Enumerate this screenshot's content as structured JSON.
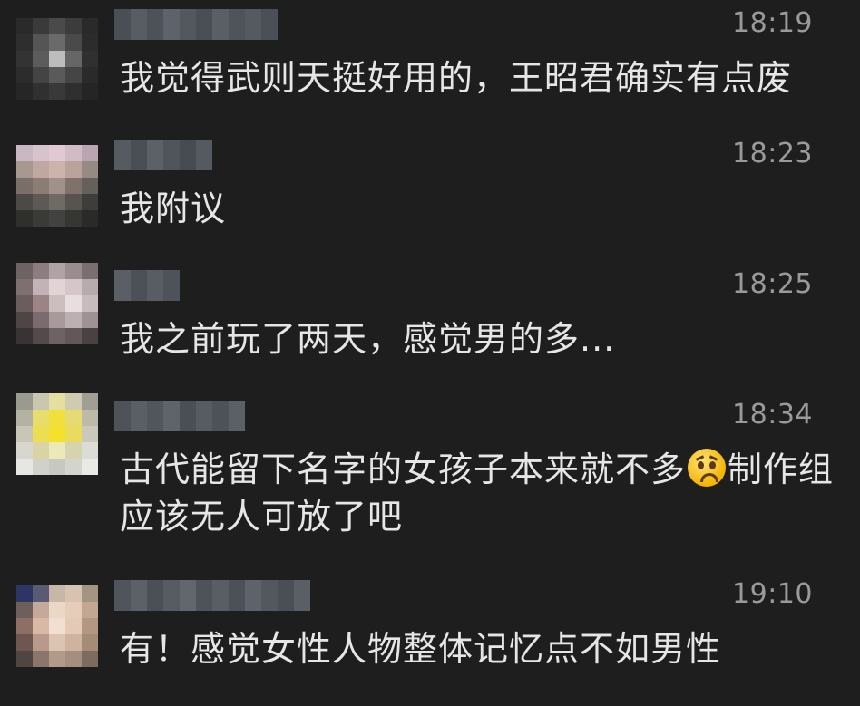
{
  "colors": {
    "background": "#1e1e1e",
    "message_text": "#e6e6e6",
    "timestamp": "#9a9a9a"
  },
  "messages": [
    {
      "time": "18:19",
      "text": "我觉得武则天挺好用的，王昭君确实有点废",
      "avatar_desc": "pixelated-avatar"
    },
    {
      "time": "18:23",
      "text": "我附议",
      "avatar_desc": "pixelated-avatar"
    },
    {
      "time": "18:25",
      "text": "我之前玩了两天，感觉男的多...",
      "avatar_desc": "pixelated-avatar"
    },
    {
      "time": "18:34",
      "text_before_emoji": "古代能留下名字的女孩子本来就不多",
      "emoji": "worried-face-icon",
      "text_after_emoji": "制作组应该无人可放了吧",
      "avatar_desc": "pixelated-avatar"
    },
    {
      "time": "19:10",
      "text": "有！感觉女性人物整体记忆点不如男性",
      "avatar_desc": "pixelated-avatar"
    }
  ]
}
